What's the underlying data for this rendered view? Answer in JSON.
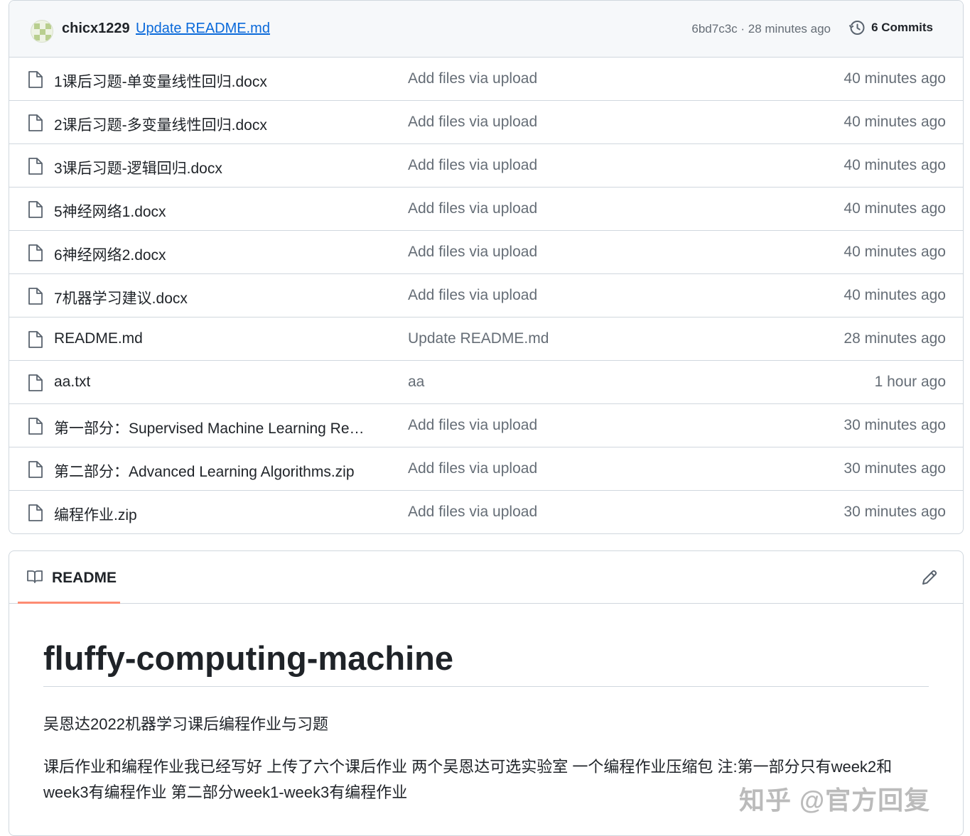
{
  "latest_commit": {
    "author": "chicx1229",
    "message": "Update README.md",
    "meta": "6bd7c3c · 28 minutes ago",
    "commits_label": "6 Commits",
    "commits_icon": "history-icon"
  },
  "files": [
    {
      "name": "1课后习题-单变量线性回归.docx",
      "commit": "Add files via upload",
      "time": "40 minutes ago"
    },
    {
      "name": "2课后习题-多变量线性回归.docx",
      "commit": "Add files via upload",
      "time": "40 minutes ago"
    },
    {
      "name": "3课后习题-逻辑回归.docx",
      "commit": "Add files via upload",
      "time": "40 minutes ago"
    },
    {
      "name": "5神经网络1.docx",
      "commit": "Add files via upload",
      "time": "40 minutes ago"
    },
    {
      "name": "6神经网络2.docx",
      "commit": "Add files via upload",
      "time": "40 minutes ago"
    },
    {
      "name": "7机器学习建议.docx",
      "commit": "Add files via upload",
      "time": "40 minutes ago"
    },
    {
      "name": "README.md",
      "commit": "Update README.md",
      "time": "28 minutes ago"
    },
    {
      "name": "aa.txt",
      "commit": "aa",
      "time": "1 hour ago"
    },
    {
      "name": "第一部分：Supervised Machine Learning Regr...",
      "commit": "Add files via upload",
      "time": "30 minutes ago"
    },
    {
      "name": "第二部分：Advanced Learning Algorithms.zip",
      "commit": "Add files via upload",
      "time": "30 minutes ago"
    },
    {
      "name": "编程作业.zip",
      "commit": "Add files via upload",
      "time": "30 minutes ago"
    }
  ],
  "readme": {
    "tab_label": "README",
    "tab_icon": "book-icon",
    "edit_icon": "pencil-icon",
    "title": "fluffy-computing-machine",
    "paragraph1": "吴恩达2022机器学习课后编程作业与习题",
    "paragraph2": "课后作业和编程作业我已经写好 上传了六个课后作业 两个吴恩达可选实验室 一个编程作业压缩包 注:第一部分只有week2和week3有编程作业 第二部分week1-week3有编程作业"
  },
  "watermark": "知乎 @官方回复",
  "colors": {
    "link": "#0969da",
    "muted": "#656d76",
    "border": "#d0d7de",
    "tab_underline": "#fd8c73"
  }
}
